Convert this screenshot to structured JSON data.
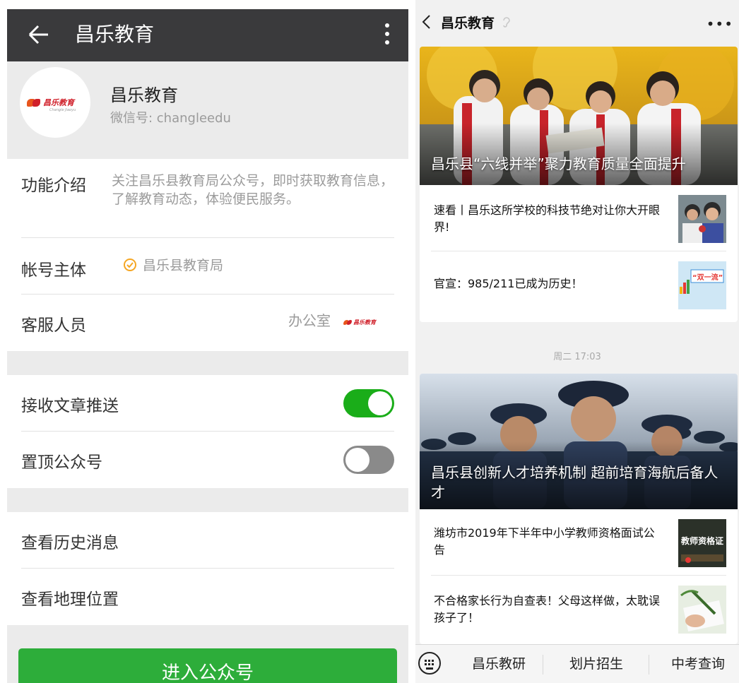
{
  "left": {
    "topbar": {
      "title": "昌乐教育"
    },
    "profile": {
      "name": "昌乐教育",
      "wechat_id": "微信号: changleedu",
      "logo_text": "昌乐教育",
      "logo_sub": "Changle Jiaoyu"
    },
    "info": {
      "intro_label": "功能介绍",
      "intro_text": "关注昌乐县教育局公众号，即时获取教育信息，了解教育动态，体验便民服务。",
      "owner_label": "帐号主体",
      "owner_value": "昌乐县教育局",
      "service_label": "客服人员",
      "service_value": "办公室"
    },
    "settings": {
      "push_label": "接收文章推送",
      "push_on": true,
      "pin_label": "置顶公众号",
      "pin_on": false
    },
    "actions": {
      "history_label": "查看历史消息",
      "location_label": "查看地理位置"
    },
    "enter_button": "进入公众号"
  },
  "right": {
    "topbar": {
      "title": "昌乐教育"
    },
    "cards": [
      {
        "hero_title": "昌乐县“六线并举”聚力教育质量全面提升",
        "items": [
          {
            "title": "速看丨昌乐这所学校的科技节绝对让你大开眼界!"
          },
          {
            "title": "官宣：985/211已成为历史！",
            "thumb_text": "“双一流”"
          }
        ]
      },
      {
        "hero_title": "昌乐县创新人才培养机制 超前培育海航后备人才",
        "items": [
          {
            "title": "潍坊市2019年下半年中小学教师资格面试公告",
            "thumb_text": "教师资格证"
          },
          {
            "title": "不合格家长行为自查表！父母这样做，太耽误孩子了！"
          }
        ]
      }
    ],
    "timestamp": "周二 17:03",
    "menu": [
      "昌乐教研",
      "划片招生",
      "中考查询"
    ]
  }
}
